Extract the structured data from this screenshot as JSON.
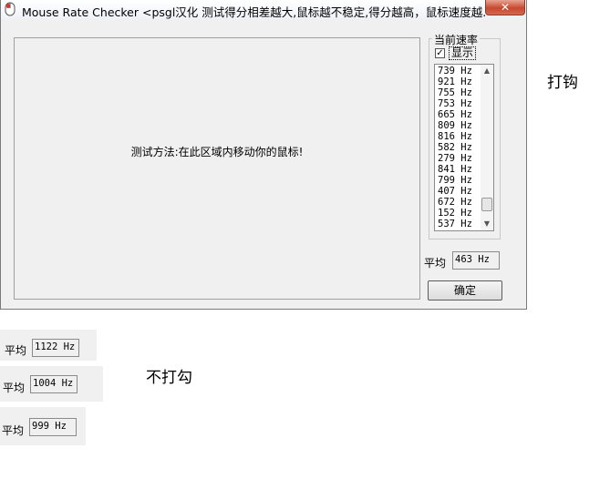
{
  "window": {
    "title": "Mouse Rate Checker <psgl汉化  测试得分相差越大,鼠标越不稳定,得分越高，鼠标速度越...",
    "close_glyph": "✕",
    "app_icon": "mouse-icon"
  },
  "draw_area": {
    "instruction": "测试方法:在此区域内移动你的鼠标!"
  },
  "rate_group": {
    "title": "当前速率",
    "show_checkbox": {
      "checked": true,
      "mark": "✓",
      "label": "显示"
    },
    "rates": [
      "739 Hz",
      "921 Hz",
      "755 Hz",
      "753 Hz",
      "665 Hz",
      "809 Hz",
      "816 Hz",
      "582 Hz",
      "279 Hz",
      "841 Hz",
      "799 Hz",
      "407 Hz",
      "672 Hz",
      "152 Hz",
      "537 Hz"
    ],
    "scroll_up": "▲",
    "scroll_down": "▼"
  },
  "average": {
    "label": "平均",
    "value": "463 Hz"
  },
  "ok_button": {
    "label": "确定"
  },
  "annotations": {
    "checked_note": "打钩",
    "unchecked_note": "不打勾"
  },
  "snippets": [
    {
      "label": "平均",
      "value": "1122 Hz"
    },
    {
      "label": "平均",
      "value": "1004 Hz"
    },
    {
      "label": "平均",
      "value": "999 Hz"
    }
  ]
}
